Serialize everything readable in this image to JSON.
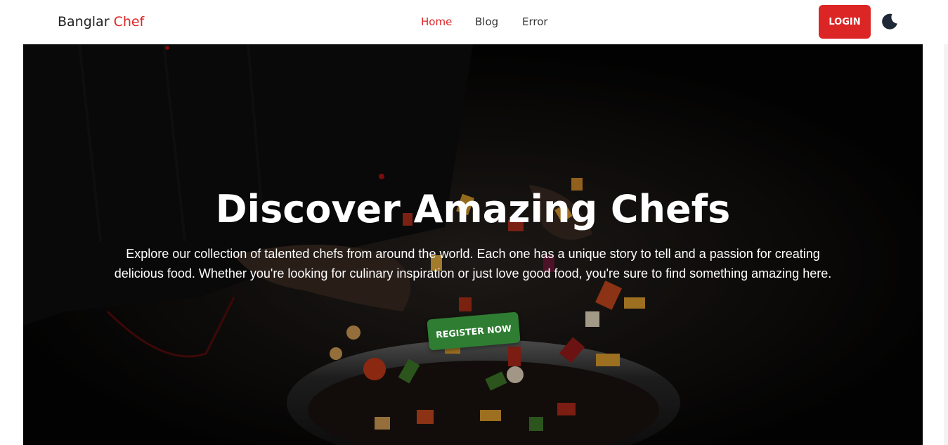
{
  "nav": {
    "brand_main": "Banglar",
    "brand_accent": "Chef",
    "links": [
      {
        "label": "Home",
        "active": true
      },
      {
        "label": "Blog",
        "active": false
      },
      {
        "label": "Error",
        "active": false
      }
    ],
    "login_label": "LOGIN",
    "theme_icon": "moon-icon"
  },
  "hero": {
    "title": "Discover Amazing Chefs",
    "description": "Explore our collection of talented chefs from around the world. Each one has a unique story to tell and a passion for creating delicious food. Whether you're looking for culinary inspiration or just love good food, you're sure to find something amazing here.",
    "cta_label": "REGISTER NOW",
    "background_image": "chef-tossing-vegetables-in-wok"
  },
  "colors": {
    "accent": "#dc2626",
    "cta": "#2e7d32",
    "text_dark": "#222222"
  }
}
